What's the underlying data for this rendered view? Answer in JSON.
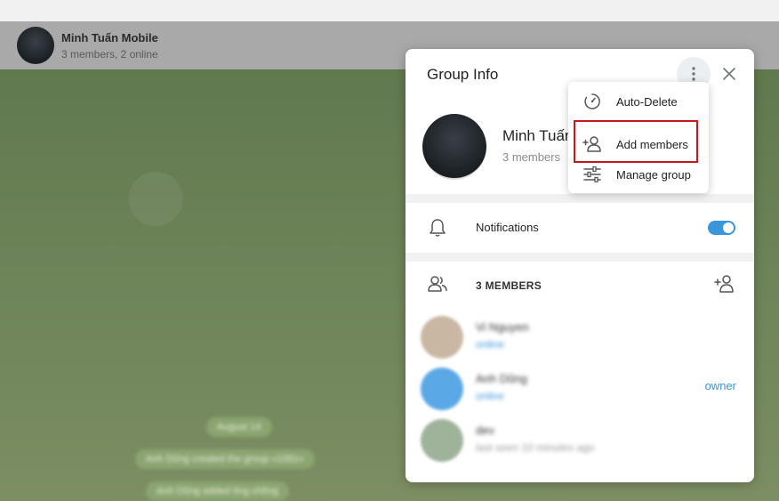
{
  "chat_header": {
    "title": "Minh Tuấn Mobile",
    "subtitle": "3 members, 2 online"
  },
  "chat_bubbles": [
    "August 14",
    "Anh Dũng created the group «1991»",
    "Anh Dũng added ông chồng"
  ],
  "group_info": {
    "title": "Group Info",
    "group_name": "Minh Tuấn Mobile",
    "group_members": "3 members",
    "notifications_label": "Notifications",
    "notifications_on": true,
    "members_header": "3 MEMBERS",
    "members": [
      {
        "name": "Vi Nguyen",
        "status": "online",
        "role": "",
        "avatar_color": "#c9b7a3"
      },
      {
        "name": "Anh Dũng",
        "status": "online",
        "role": "owner",
        "avatar_color": "#5aa9e6"
      },
      {
        "name": "dev",
        "status": "last seen 10 minutes ago",
        "role": "",
        "avatar_color": "#9fb39a"
      }
    ]
  },
  "context_menu": {
    "items": [
      {
        "label": "Auto-Delete",
        "icon": "timer-icon"
      },
      {
        "label": "Add members",
        "icon": "add-user-icon"
      },
      {
        "label": "Manage group",
        "icon": "sliders-icon"
      }
    ],
    "highlighted": "Add members",
    "highlight_color": "#c8161d"
  },
  "colors": {
    "accent": "#3a95d9"
  }
}
